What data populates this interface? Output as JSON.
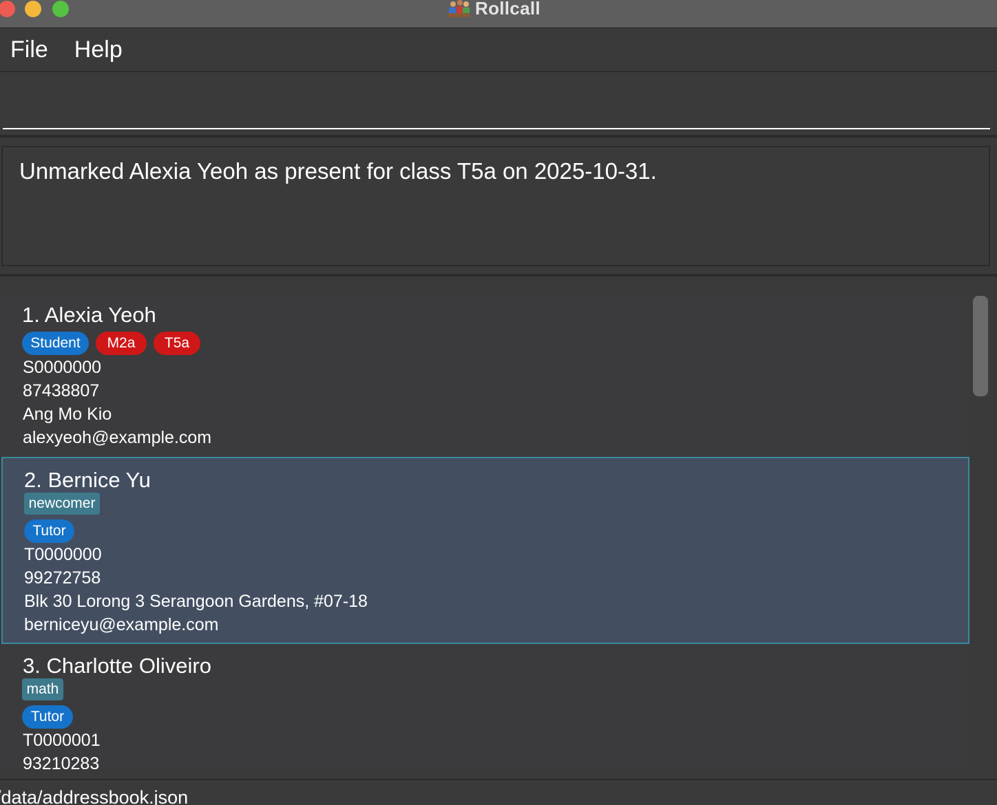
{
  "window": {
    "title": "Rollcall",
    "icon": "rollcall-app-icon"
  },
  "menu": {
    "file": "File",
    "help": "Help"
  },
  "command": {
    "value": "",
    "placeholder": ""
  },
  "result": {
    "message": "Unmarked Alexia Yeoh as present for class T5a on 2025-10-31."
  },
  "persons": [
    {
      "name": "1. Alexia Yeoh",
      "tags": [
        {
          "label": "Student",
          "kind": "role"
        },
        {
          "label": "M2a",
          "kind": "class"
        },
        {
          "label": "T5a",
          "kind": "class"
        }
      ],
      "id": "S0000000",
      "phone": "87438807",
      "address": "Ang Mo Kio",
      "email": "alexyeoh@example.com"
    },
    {
      "name": "2. Bernice Yu",
      "tags": [
        {
          "label": "newcomer",
          "kind": "tag"
        },
        {
          "label": "Tutor",
          "kind": "role"
        }
      ],
      "id": "T0000000",
      "phone": "99272758",
      "address": "Blk 30 Lorong 3 Serangoon Gardens, #07-18",
      "email": "berniceyu@example.com",
      "selected": true
    },
    {
      "name": "3. Charlotte Oliveiro",
      "tags": [
        {
          "label": "math",
          "kind": "tag"
        },
        {
          "label": "Tutor",
          "kind": "role"
        }
      ],
      "id": "T0000001",
      "phone": "93210283"
    }
  ],
  "status": {
    "path": "/data/addressbook.json"
  },
  "colors": {
    "background": "#3a3a3a",
    "selected_card": "#434f61",
    "role_tag": "#1573c9",
    "class_tag": "#d01717",
    "plain_tag": "#3f7a8c"
  }
}
